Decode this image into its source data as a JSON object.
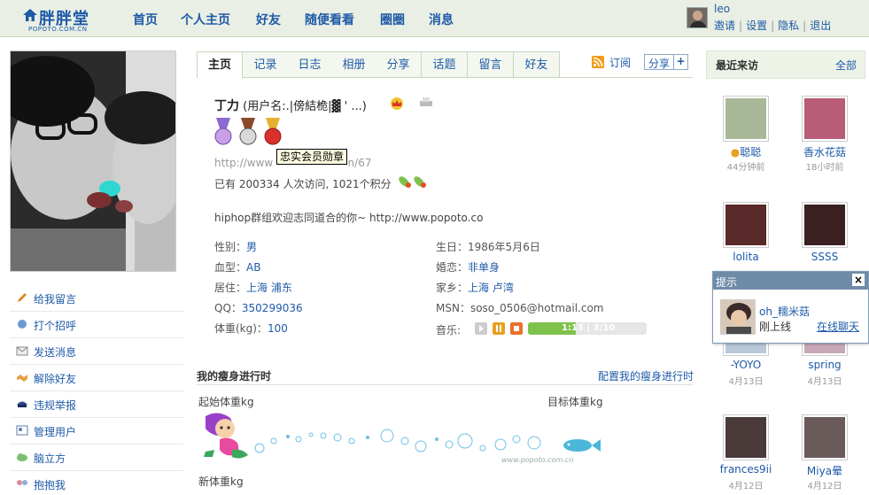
{
  "site": {
    "brand": "胖胖堂",
    "domain": "POPOTO.COM.CN"
  },
  "nav": [
    "首页",
    "个人主页",
    "好友",
    "随便看看",
    "圈圈",
    "消息"
  ],
  "user": {
    "name": "leo",
    "links": [
      "邀请",
      "设置",
      "隐私",
      "退出"
    ]
  },
  "actions": [
    {
      "label": "给我留言",
      "icon": "pencil-icon"
    },
    {
      "label": "打个招呼",
      "icon": "wave-icon"
    },
    {
      "label": "发送消息",
      "icon": "envelope-icon"
    },
    {
      "label": "解除好友",
      "icon": "handshake-icon"
    },
    {
      "label": "违规举报",
      "icon": "police-cap-icon"
    },
    {
      "label": "管理用户",
      "icon": "user-card-icon"
    },
    {
      "label": "脑立方",
      "icon": "cloud-icon"
    },
    {
      "label": "抱抱我",
      "icon": "hug-icon"
    }
  ],
  "tabs": [
    "主页",
    "记录",
    "日志",
    "相册",
    "分享",
    "话题",
    "留言",
    "好友"
  ],
  "subscribe_label": "订阅",
  "share_label": "分享",
  "profile": {
    "name": "丁力",
    "alias": "(用户名:.|傍結桅|▓ ' ...)",
    "url": "http://www.popoto.com.cn/67",
    "url_visible_start": "http://www",
    "url_visible_end": "n/67",
    "visits": "已有 200334 人次访问, 1021个积分",
    "motto": "hiphop群组欢迎志同道合的你~ http://www.popoto.co",
    "badge_tooltip": "忠实会员勋章"
  },
  "fields_left": [
    {
      "label": "性别：",
      "value": "男"
    },
    {
      "label": "血型：",
      "value": "AB"
    },
    {
      "label": "居住：",
      "value": "上海 浦东"
    },
    {
      "label": "QQ：",
      "value": "350299036"
    },
    {
      "label": "体重(kg)：",
      "value": "100"
    }
  ],
  "fields_right": [
    {
      "label": "生日：",
      "value": "1986年5月6日"
    },
    {
      "label": "婚恋：",
      "value": "非单身"
    },
    {
      "label": "家乡：",
      "value": "上海 卢湾"
    },
    {
      "label": "MSN：",
      "value": "soso_0506@hotmail.com"
    }
  ],
  "music": {
    "label": "音乐:",
    "time": "1:13 | 3:10",
    "progress": 0.4
  },
  "diet": {
    "title": "我的瘦身进行时",
    "config": "配置我的瘦身进行时",
    "start": "起始体重kg",
    "target": "目标体重kg",
    "new": "新体重kg",
    "watermark": "www.popoto.com.cn"
  },
  "visitors": {
    "title": "最近来访",
    "all": "全部",
    "items": [
      {
        "name": "聪聪",
        "time": "44分钟前",
        "color": "#a8b898"
      },
      {
        "name": "香水花菇",
        "time": "18小时前",
        "color": "#b85c78"
      },
      {
        "name": "lolita",
        "time": "",
        "color": "#5a2a2a"
      },
      {
        "name": "SSSS",
        "time": "",
        "color": "#3a2020"
      },
      {
        "name": "-YOYO",
        "time": "4月13日",
        "color": "#b8c8d8"
      },
      {
        "name": "spring",
        "time": "4月13日",
        "color": "#c8a8b8"
      },
      {
        "name": "frances9ii",
        "time": "4月12日",
        "color": "#4a3a3a"
      },
      {
        "name": "Miya晕",
        "time": "4月12日",
        "color": "#6a5a5a"
      }
    ]
  },
  "popup": {
    "title": "提示",
    "name": "oh_糯米菇",
    "status": "刚上线",
    "chat": "在线聊天"
  }
}
